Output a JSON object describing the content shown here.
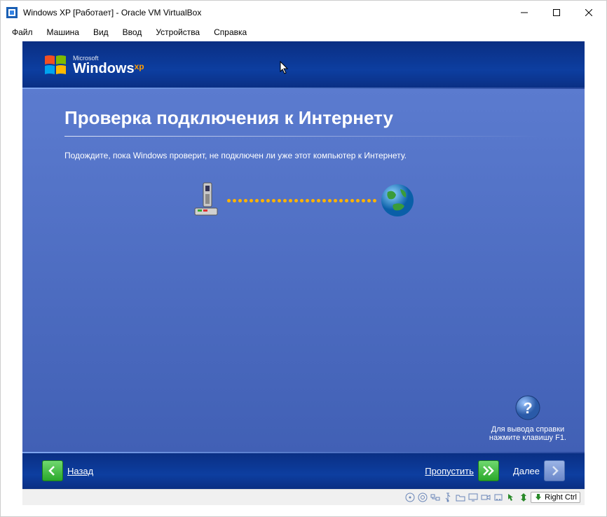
{
  "window": {
    "title": "Windows XP [Работает] - Oracle VM VirtualBox"
  },
  "menu": {
    "file": "Файл",
    "machine": "Машина",
    "view": "Вид",
    "input": "Ввод",
    "devices": "Устройства",
    "help": "Справка"
  },
  "logo": {
    "ms": "Microsoft",
    "win": "Windows",
    "xp": "xp"
  },
  "page": {
    "heading": "Проверка подключения к Интернету",
    "subtitle": "Подождите, пока Windows проверит, не подключен ли уже этот компьютер к Интернету."
  },
  "help": {
    "line1": "Для вывода справки",
    "line2": "нажмите клавишу F1."
  },
  "nav": {
    "back": "Назад",
    "skip": "Пропустить",
    "next": "Далее"
  },
  "statusbar": {
    "hostkey": "Right Ctrl"
  }
}
